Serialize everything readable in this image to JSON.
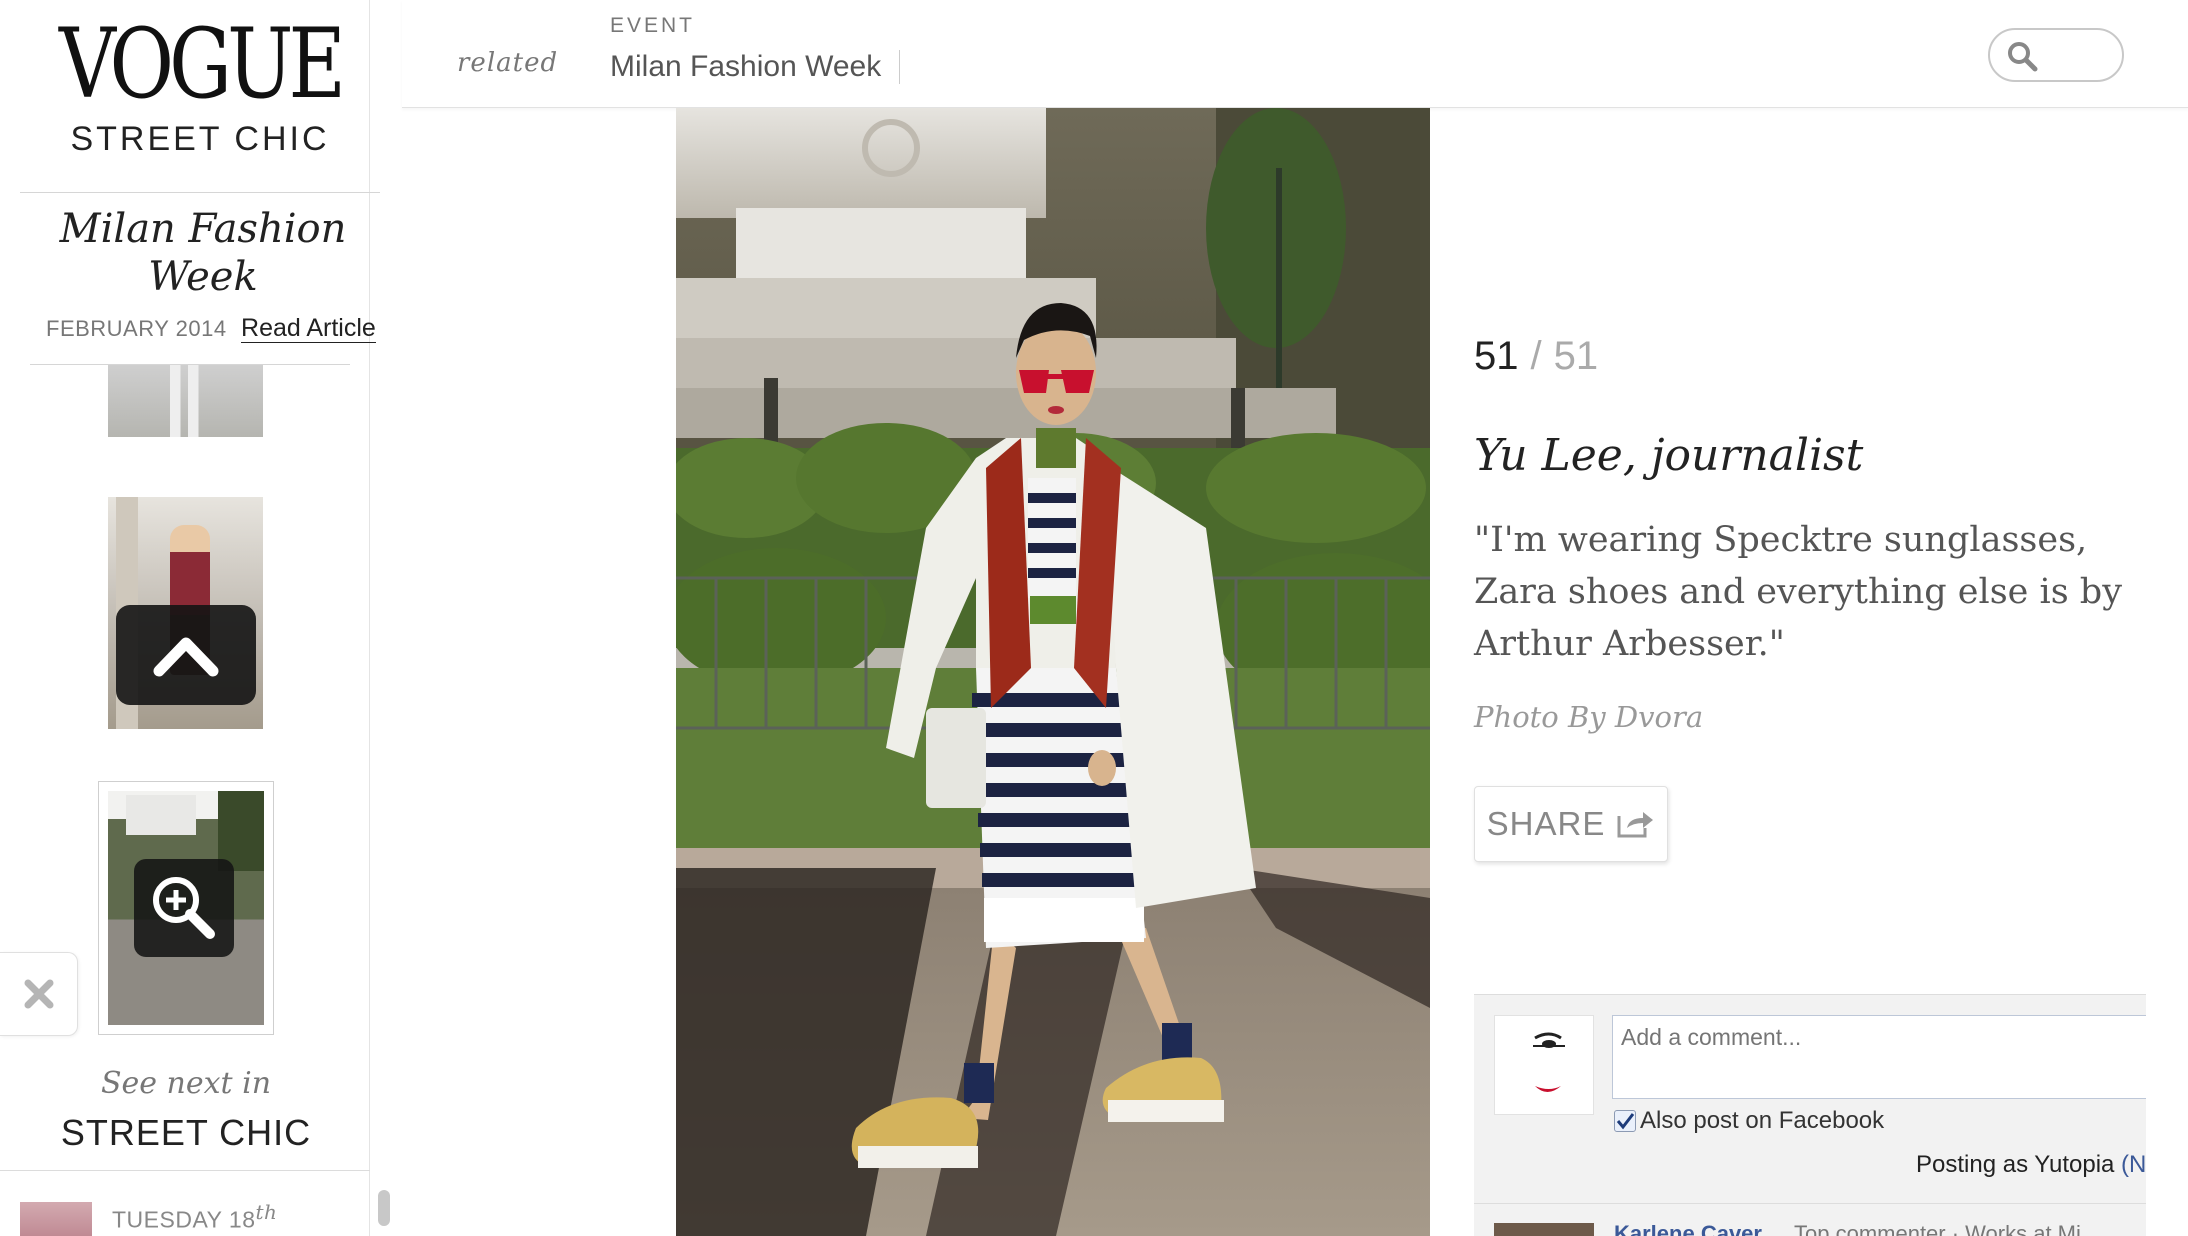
{
  "brand": {
    "logo": "VOGUE",
    "section": "STREET CHIC"
  },
  "event": {
    "title_line1": "Milan Fashion",
    "title_line2": "Week",
    "date": "FEBRUARY 2014",
    "read_link": "Read Article"
  },
  "topbar": {
    "related_label": "related",
    "event_label": "EVENT",
    "event_name": "Milan Fashion Week",
    "search_placeholder": ""
  },
  "sidebar": {
    "see_next_label": "See next in",
    "next_section": "STREET CHIC",
    "next_item_date": "TUESDAY 18",
    "next_item_date_suffix": "th"
  },
  "slide": {
    "current": "51",
    "separator": "/",
    "total": "51",
    "title": "Yu Lee, journalist",
    "quote": "\"I'm wearing Specktre sunglasses, Zara shoes and everything else is by Arthur Arbesser.\"",
    "credit": "Photo By Dvora",
    "share_label": "SHARE"
  },
  "comments": {
    "input_placeholder": "Add a comment...",
    "also_post_label": "Also post on Facebook",
    "also_post_checked": true,
    "posting_as_prefix": "Posting as Yutopia ",
    "posting_as_suffix": "(N",
    "next_commenter": "Karlene Caver",
    "next_commenter_meta": "Top commenter · Works at Mi"
  },
  "colors": {
    "facebook_blue": "#3b5998",
    "accent_red": "#c8102e"
  }
}
